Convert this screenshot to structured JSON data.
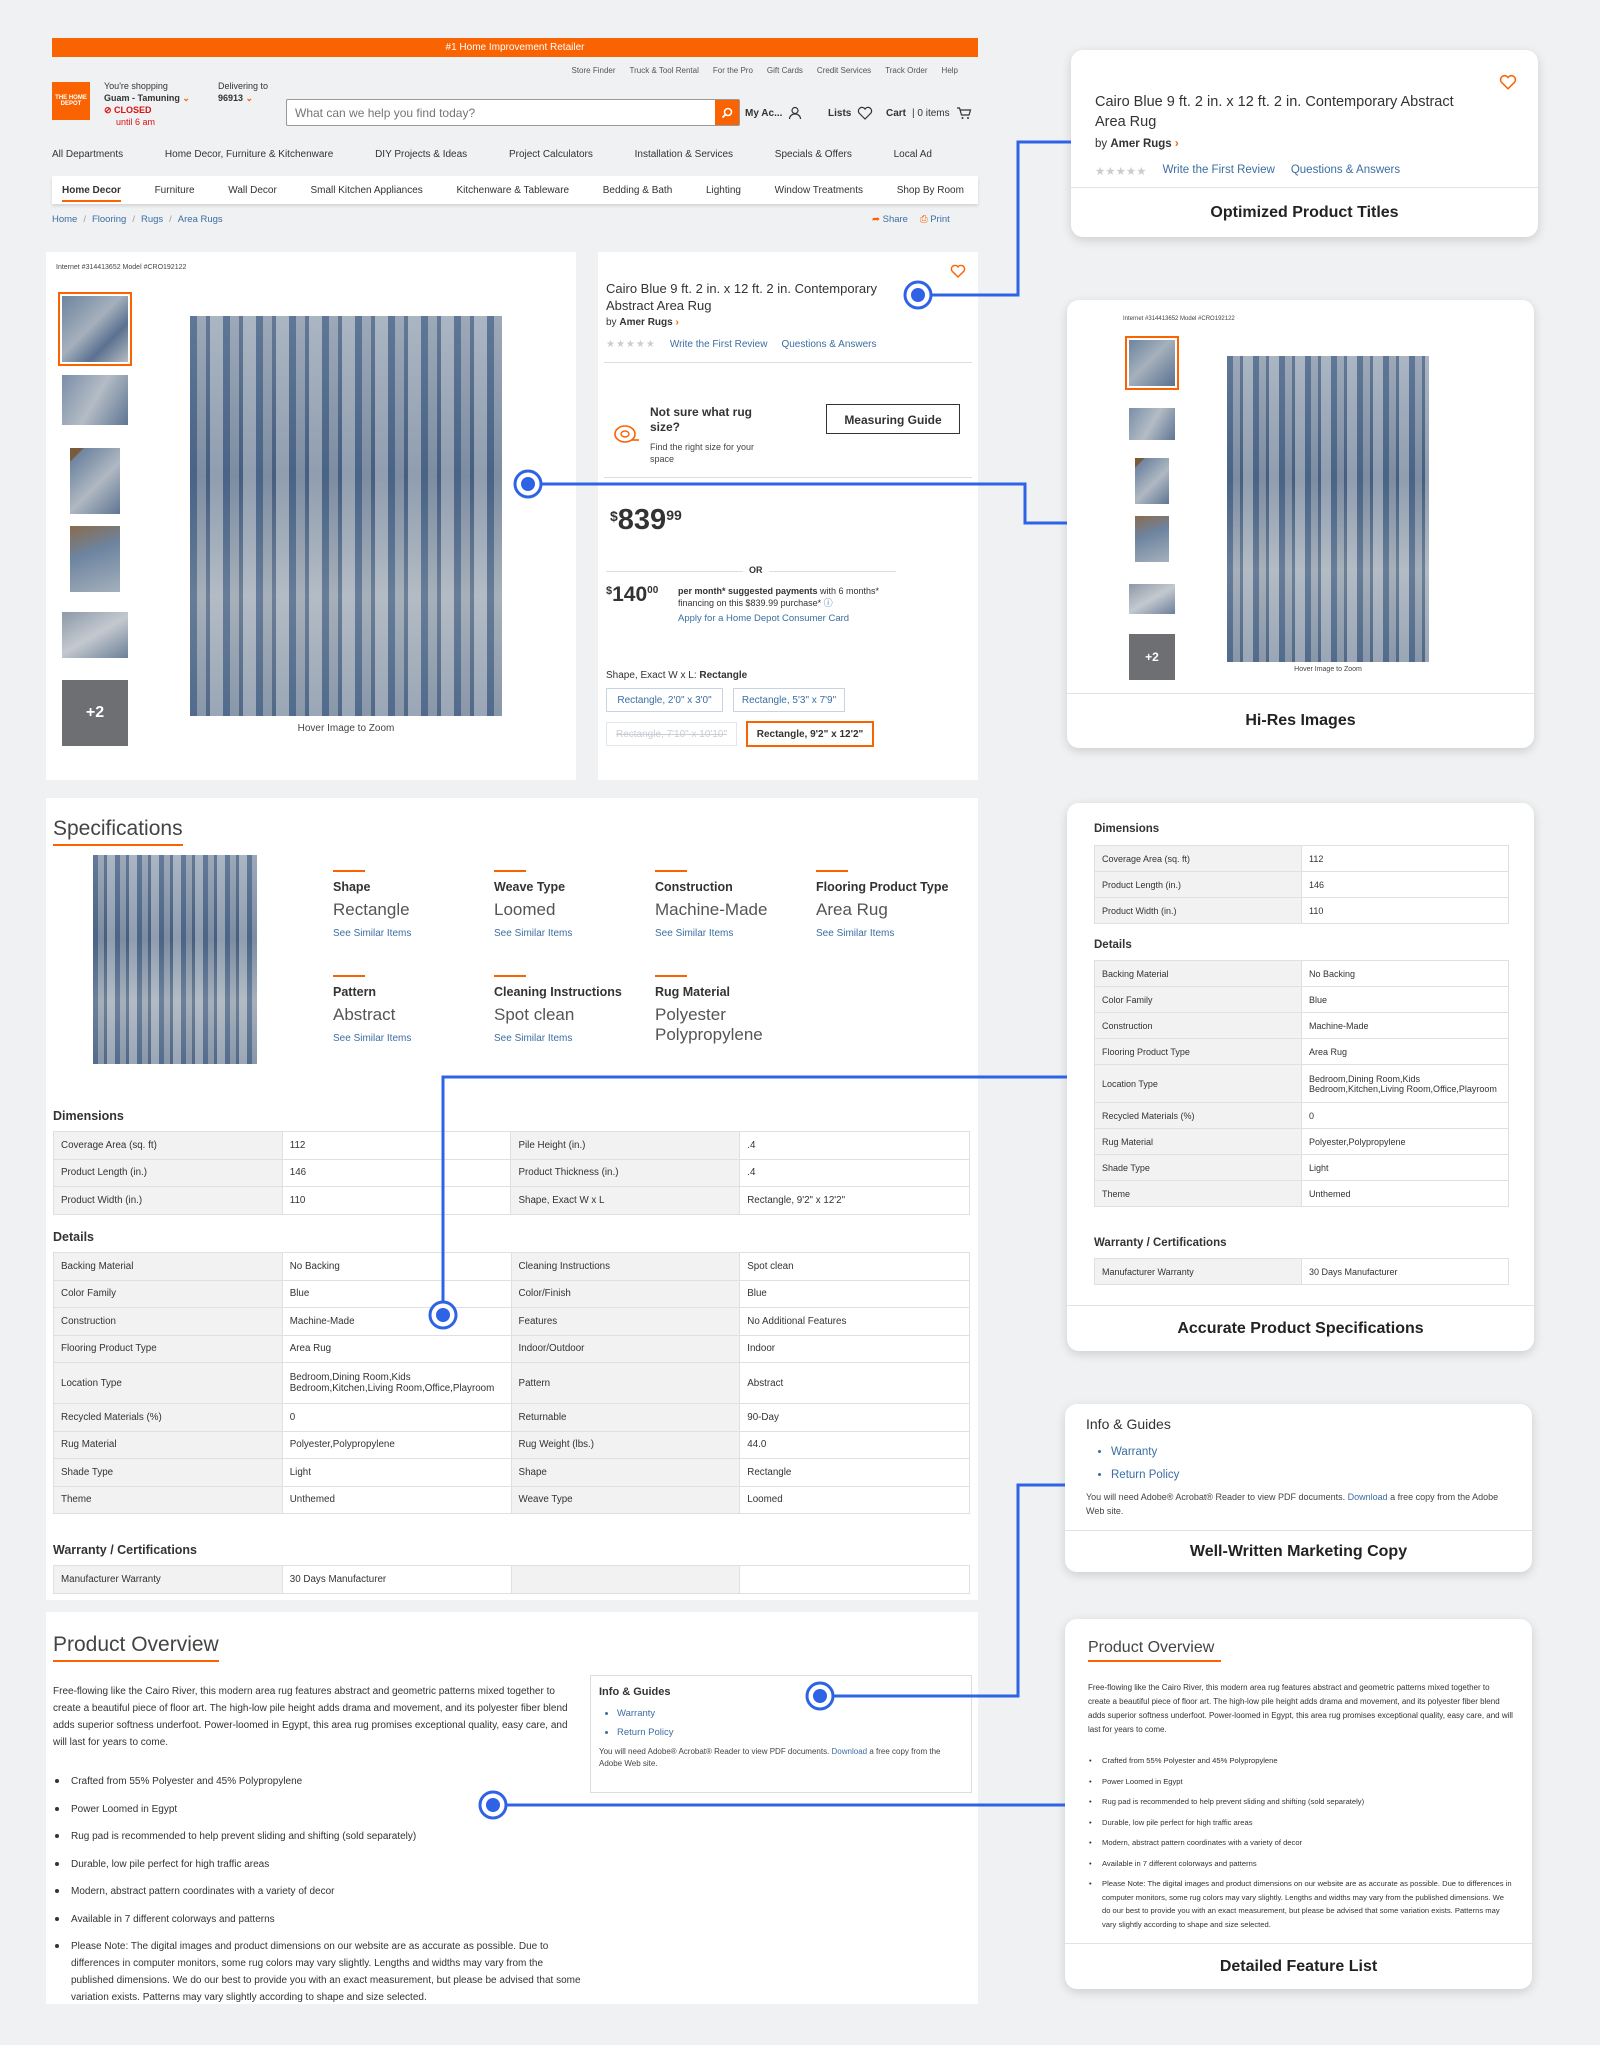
{
  "banner": "#1 Home Improvement Retailer",
  "utility_links": [
    "Store Finder",
    "Truck & Tool Rental",
    "For the Pro",
    "Gift Cards",
    "Credit Services",
    "Track Order",
    "Help"
  ],
  "logo_text": "THE HOME DEPOT",
  "store": {
    "prefix": "You're shopping",
    "name": "Guam - Tamuning",
    "status": "CLOSED",
    "until": "until 6 am"
  },
  "delivery": {
    "label": "Delivering to",
    "zip": "96913"
  },
  "search": {
    "placeholder": "What can we help you find today?"
  },
  "account": {
    "my_account": "My Ac...",
    "lists": "Lists",
    "cart": "Cart",
    "cart_count": "0 items"
  },
  "nav_primary": [
    "All Departments",
    "Home Decor, Furniture & Kitchenware",
    "DIY Projects & Ideas",
    "Project Calculators",
    "Installation & Services",
    "Specials & Offers",
    "Local Ad"
  ],
  "nav_secondary": [
    "Home Decor",
    "Furniture",
    "Wall Decor",
    "Small Kitchen Appliances",
    "Kitchenware & Tableware",
    "Bedding & Bath",
    "Lighting",
    "Window Treatments",
    "Shop By Room"
  ],
  "breadcrumb": [
    "Home",
    "Flooring",
    "Rugs",
    "Area Rugs"
  ],
  "share": "Share",
  "print": "Print",
  "ids": "Internet #314413652   Model #CRO192122",
  "product": {
    "title": "Cairo Blue 9 ft. 2 in. x 12 ft. 2 in. Contemporary Abstract Area Rug",
    "by": "by",
    "brand": "Amer Rugs",
    "write_review": "Write the First Review",
    "qa": "Questions & Answers",
    "hover_zoom": "Hover Image to Zoom",
    "more_images": "+2",
    "size_prompt": "Not sure what rug size?",
    "size_help": "Find the right size for your space",
    "measuring_guide": "Measuring Guide",
    "price_dollars": "839",
    "price_cents": "99",
    "or": "OR",
    "monthly_dollars": "140",
    "monthly_cents": "00",
    "monthly_bold": "per month* suggested payments",
    "monthly_text": " with 6 months* financing on this $839.99 purchase*",
    "apply": "Apply for a Home Depot Consumer Card",
    "shape_label": "Shape, Exact W x L:",
    "shape_value": "Rectangle",
    "sizes": [
      "Rectangle, 2'0\" x 3'0\"",
      "Rectangle, 5'3\" x 7'9\"",
      "Rectangle, 7'10\" x 10'10\"",
      "Rectangle, 9'2\" x 12'2\""
    ]
  },
  "specifications": {
    "heading": "Specifications",
    "see_similar": "See Similar Items",
    "attributes": [
      {
        "k": "Shape",
        "v": "Rectangle",
        "link": true
      },
      {
        "k": "Weave Type",
        "v": "Loomed",
        "link": true
      },
      {
        "k": "Construction",
        "v": "Machine-Made",
        "link": true
      },
      {
        "k": "Flooring Product Type",
        "v": "Area Rug",
        "link": true
      },
      {
        "k": "Pattern",
        "v": "Abstract",
        "link": true
      },
      {
        "k": "Cleaning Instructions",
        "v": "Spot clean",
        "link": true
      },
      {
        "k": "Rug Material",
        "v": "Polyester Polypropylene",
        "link": false
      }
    ],
    "dimensions_heading": "Dimensions",
    "dimensions": [
      [
        "Coverage Area (sq. ft)",
        "112",
        "Pile Height (in.)",
        ".4"
      ],
      [
        "Product Length (in.)",
        "146",
        "Product Thickness (in.)",
        ".4"
      ],
      [
        "Product Width (in.)",
        "110",
        "Shape, Exact W x L",
        "Rectangle, 9'2\" x 12'2\""
      ]
    ],
    "details_heading": "Details",
    "details": [
      [
        "Backing Material",
        "No Backing",
        "Cleaning Instructions",
        "Spot clean"
      ],
      [
        "Color Family",
        "Blue",
        "Color/Finish",
        "Blue"
      ],
      [
        "Construction",
        "Machine-Made",
        "Features",
        "No Additional Features"
      ],
      [
        "Flooring Product Type",
        "Area Rug",
        "Indoor/Outdoor",
        "Indoor"
      ],
      [
        "Location Type",
        "Bedroom,Dining Room,Kids Bedroom,Kitchen,Living Room,Office,Playroom",
        "Pattern",
        "Abstract"
      ],
      [
        "Recycled Materials (%)",
        "0",
        "Returnable",
        "90-Day"
      ],
      [
        "Rug Material",
        "Polyester,Polypropylene",
        "Rug Weight (lbs.)",
        "44.0"
      ],
      [
        "Shade Type",
        "Light",
        "Shape",
        "Rectangle"
      ],
      [
        "Theme",
        "Unthemed",
        "Weave Type",
        "Loomed"
      ]
    ],
    "warranty_heading": "Warranty / Certifications",
    "warranty": [
      [
        "Manufacturer Warranty",
        "30 Days Manufacturer",
        "",
        ""
      ]
    ]
  },
  "overview": {
    "heading": "Product Overview",
    "paragraph": "Free-flowing like the Cairo River, this modern area rug features abstract and geometric patterns mixed together to create a beautiful piece of floor art. The high-low pile height adds drama and movement, and its polyester fiber blend adds superior softness underfoot. Power-loomed in Egypt, this area rug promises exceptional quality, easy care, and will last for years to come.",
    "features": [
      "Crafted from 55% Polyester and 45% Polypropylene",
      "Power Loomed in Egypt",
      "Rug pad is recommended to help prevent sliding and shifting (sold separately)",
      "Durable, low pile perfect for high traffic areas",
      "Modern, abstract pattern coordinates with a variety of decor",
      "Available in 7 different colorways and patterns",
      "Please Note: The digital images and product dimensions on our website are as accurate as possible. Due to differences in computer monitors, some rug colors may vary slightly. Lengths and widths may vary from the published dimensions. We do our best to provide you with an exact measurement, but please be advised that some variation exists. Patterns may vary slightly according to shape and size selected."
    ],
    "info_heading": "Info & Guides",
    "info_links": [
      "Warranty",
      "Return Policy"
    ],
    "pdf_pre": "You will need Adobe® Acrobat® Reader to view PDF documents. ",
    "pdf_link": "Download",
    "pdf_post": " a free copy from the Adobe Web site."
  },
  "callouts": {
    "titles": "Optimized Product Titles",
    "images": "Hi-Res Images",
    "specs": "Accurate Product Specifications",
    "copy": "Well-Written Marketing Copy",
    "features": "Detailed Feature List"
  },
  "card_specs": {
    "dimensions": [
      [
        "Coverage Area (sq. ft)",
        "112"
      ],
      [
        "Product Length (in.)",
        "146"
      ],
      [
        "Product Width (in.)",
        "110"
      ]
    ],
    "details": [
      [
        "Backing Material",
        "No Backing"
      ],
      [
        "Color Family",
        "Blue"
      ],
      [
        "Construction",
        "Machine-Made"
      ],
      [
        "Flooring Product Type",
        "Area Rug"
      ],
      [
        "Location Type",
        "Bedroom,Dining Room,Kids Bedroom,Kitchen,Living Room,Office,Playroom"
      ],
      [
        "Recycled Materials (%)",
        "0"
      ],
      [
        "Rug Material",
        "Polyester,Polypropylene"
      ],
      [
        "Shade Type",
        "Light"
      ],
      [
        "Theme",
        "Unthemed"
      ]
    ],
    "warranty": [
      [
        "Manufacturer Warranty",
        "30 Days Manufacturer"
      ]
    ]
  },
  "colors": {
    "brand_orange": "#f96302",
    "link_blue": "#3b6ea3",
    "callout_blue": "#2f63e6"
  }
}
